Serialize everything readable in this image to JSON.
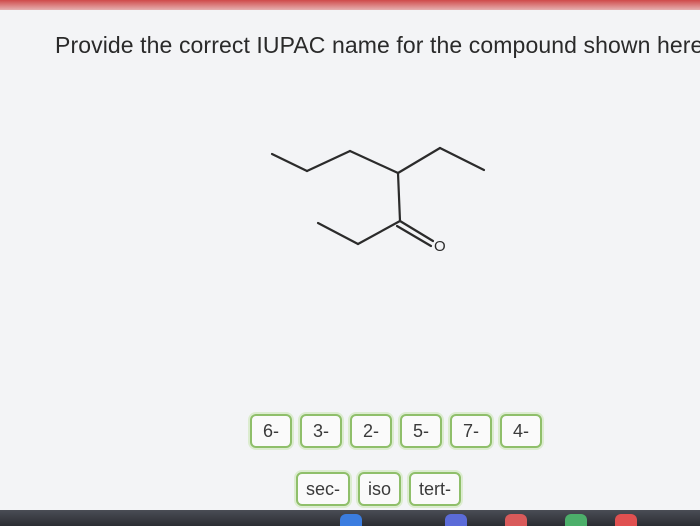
{
  "question": {
    "text": "Provide the correct IUPAC name for the compound shown here"
  },
  "molecule": {
    "atom_label": "O"
  },
  "locant_buttons": [
    "6-",
    "3-",
    "2-",
    "5-",
    "7-",
    "4-"
  ],
  "prefix_buttons": [
    "sec-",
    "iso",
    "tert-"
  ],
  "colors": {
    "chip_border": "#8fbf6a",
    "background": "#f3f4f6",
    "bond": "#2b2b2b"
  }
}
